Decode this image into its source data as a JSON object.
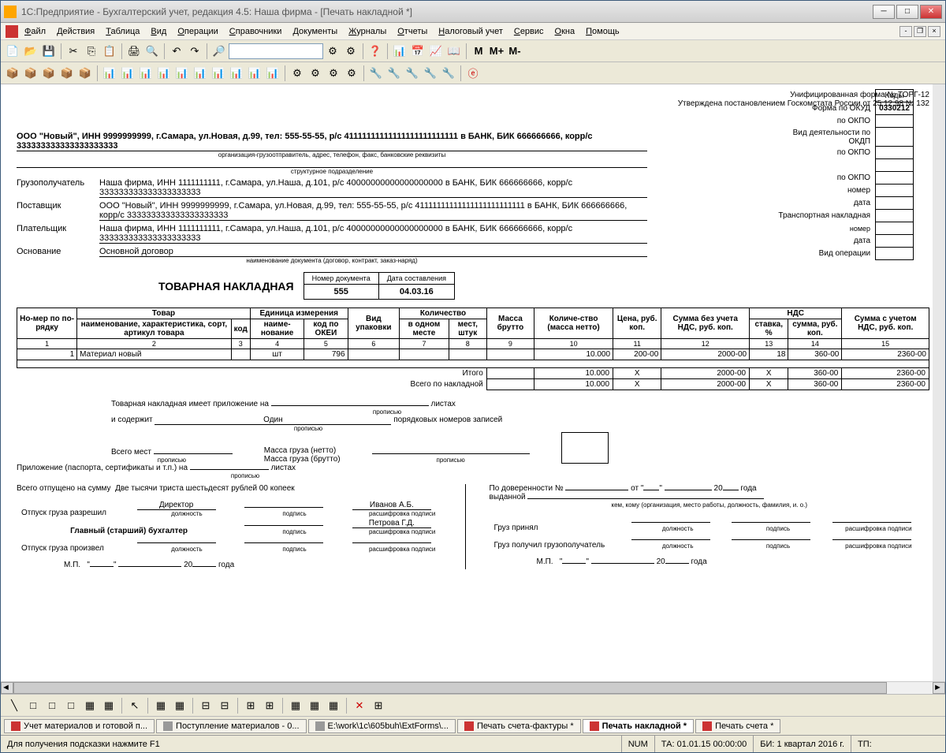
{
  "window": {
    "title": "1С:Предприятие - Бухгалтерский учет, редакция 4.5: Наша фирма - [Печать накладной *]"
  },
  "menu": [
    "Файл",
    "Действия",
    "Таблица",
    "Вид",
    "Операции",
    "Справочники",
    "Документы",
    "Журналы",
    "Отчеты",
    "Налоговый учет",
    "Сервис",
    "Окна",
    "Помощь"
  ],
  "form": {
    "form_line1": "Унифицированная форма № ТОРГ-12",
    "form_line2": "Утверждена постановлением Госкомстата России от 25.12.98 № 132",
    "codes_header": "Коды",
    "okud_label": "Форма по ОКУД",
    "okud": "0330212",
    "okpo_label": "по ОКПО",
    "okdp_label": "Вид деятельности по ОКДП",
    "nomer_label": "номер",
    "data_label": "дата",
    "trans_label": "Транспортная накладная",
    "vid_op_label": "Вид операции"
  },
  "sender": {
    "text": "ООО \"Новый\", ИНН 9999999999, г.Самара, ул.Новая, д.99, тел: 555-55-55, р/с 41111111111111111111111111 в БАНК, БИК 666666666, корр/с 333333333333333333333",
    "caption": "организация-грузоотправитель, адрес, телефон, факс, банковские реквизиты",
    "struct_caption": "структурное подразделение"
  },
  "receiver": {
    "label": "Грузополучатель",
    "text": "Наша фирма, ИНН 1111111111, г.Самара, ул.Наша, д.101, р/с 40000000000000000000 в БАНК, БИК 666666666, корр/с 333333333333333333333"
  },
  "supplier": {
    "label": "Поставщик",
    "text": "ООО \"Новый\", ИНН 9999999999, г.Самара, ул.Новая, д.99, тел: 555-55-55, р/с 41111111111111111111111111 в БАНК, БИК 666666666, корр/с 333333333333333333333"
  },
  "payer": {
    "label": "Плательщик",
    "text": "Наша фирма, ИНН 1111111111, г.Самара, ул.Наша, д.101, р/с 40000000000000000000 в БАНК, БИК 666666666, корр/с 333333333333333333333"
  },
  "basis": {
    "label": "Основание",
    "text": "Основной договор",
    "caption": "наименование документа (договор, контракт, заказ-наряд)"
  },
  "doc": {
    "title": "ТОВАРНАЯ НАКЛАДНАЯ",
    "num_header": "Номер документа",
    "date_header": "Дата составления",
    "number": "555",
    "date": "04.03.16"
  },
  "table": {
    "headers1": {
      "no": "Но-мер по по-рядку",
      "product": "Товар",
      "unit": "Единица измерения",
      "pack": "Вид упаковки",
      "qty": "Количество",
      "mass_gross": "Масса брутто",
      "qty_net": "Количе-ство (масса нетто)",
      "price": "Цена, руб. коп.",
      "sum_no_vat": "Сумма без учета НДС, руб. коп.",
      "vat": "НДС",
      "sum_vat": "Сумма с учетом НДС, руб. коп."
    },
    "headers2": {
      "name": "наименование, характеристика, сорт, артикул товара",
      "code": "код",
      "unit_name": "наиме-нование",
      "okei": "код по ОКЕИ",
      "in_one": "в одном месте",
      "places": "мест, штук",
      "rate": "ставка, %",
      "sum": "сумма, руб. коп."
    },
    "cols": [
      "1",
      "2",
      "3",
      "4",
      "5",
      "6",
      "7",
      "8",
      "9",
      "10",
      "11",
      "12",
      "13",
      "14",
      "15"
    ],
    "rows": [
      {
        "no": "1",
        "name": "Материал новый",
        "code": "",
        "unit": "шт",
        "okei": "796",
        "pack": "",
        "in_one": "",
        "places": "",
        "gross": "",
        "netto": "10.000",
        "price": "200-00",
        "sum_no_vat": "2000-00",
        "rate": "18",
        "vat_sum": "360-00",
        "sum": "2360-00"
      }
    ],
    "totals": {
      "itogo": "Итого",
      "itogo_vals": {
        "netto": "10.000",
        "price": "X",
        "sum_no_vat": "2000-00",
        "rate": "X",
        "vat_sum": "360-00",
        "sum": "2360-00"
      },
      "vsego": "Всего по накладной",
      "vsego_vals": {
        "netto": "10.000",
        "price": "X",
        "sum_no_vat": "2000-00",
        "rate": "X",
        "vat_sum": "360-00",
        "sum": "2360-00"
      }
    }
  },
  "footer": {
    "appendix": "Товарная накладная имеет приложение на",
    "sheets": "листах",
    "contains": "и содержит",
    "one": "Один",
    "propisyu": "прописью",
    "records": "порядковых номеров записей",
    "total_places": "Всего мест",
    "mass_net": "Масса груза (нетто)",
    "mass_gross": "Масса груза (брутто)",
    "app2": "Приложение (паспорта, сертификаты и т.п.) на",
    "sum_text_label": "Всего отпущено на сумму",
    "sum_text": "Две тысячи триста шестьдесят рублей 00 копеек",
    "auth_label": "Отпуск груза разрешил",
    "director": "Директор",
    "director_name": "Иванов А.Б.",
    "chief_acc": "Главный (старший) бухгалтер",
    "acc_name": "Петрова Г.Д.",
    "release_label": "Отпуск груза произвел",
    "dolzhnost": "должность",
    "podpis": "подпись",
    "rasshifrovka": "расшифровка подписи",
    "mp": "М.П.",
    "year": "года",
    "twenty": "20",
    "proxy_label": "По доверенности №",
    "ot": "от",
    "issued": "выданной",
    "issued_caption": "кем, кому (организация, место работы, должность, фамилия, и. о.)",
    "accepted": "Груз принял",
    "received": "Груз получил грузополучатель"
  },
  "tabs": [
    {
      "label": "Учет материалов и готовой п...",
      "active": false
    },
    {
      "label": "Поступление материалов - 0...",
      "active": false
    },
    {
      "label": "E:\\work\\1c\\605buh\\ExtForms\\...",
      "active": false
    },
    {
      "label": "Печать счета-фактуры *",
      "active": false
    },
    {
      "label": "Печать накладной *",
      "active": true
    },
    {
      "label": "Печать счета *",
      "active": false
    }
  ],
  "status": {
    "hint": "Для получения подсказки нажмите F1",
    "num": "NUM",
    "ta": "ТА: 01.01.15 00:00:00",
    "bi": "БИ: 1 квартал 2016 г.",
    "tp": "ТП:"
  }
}
